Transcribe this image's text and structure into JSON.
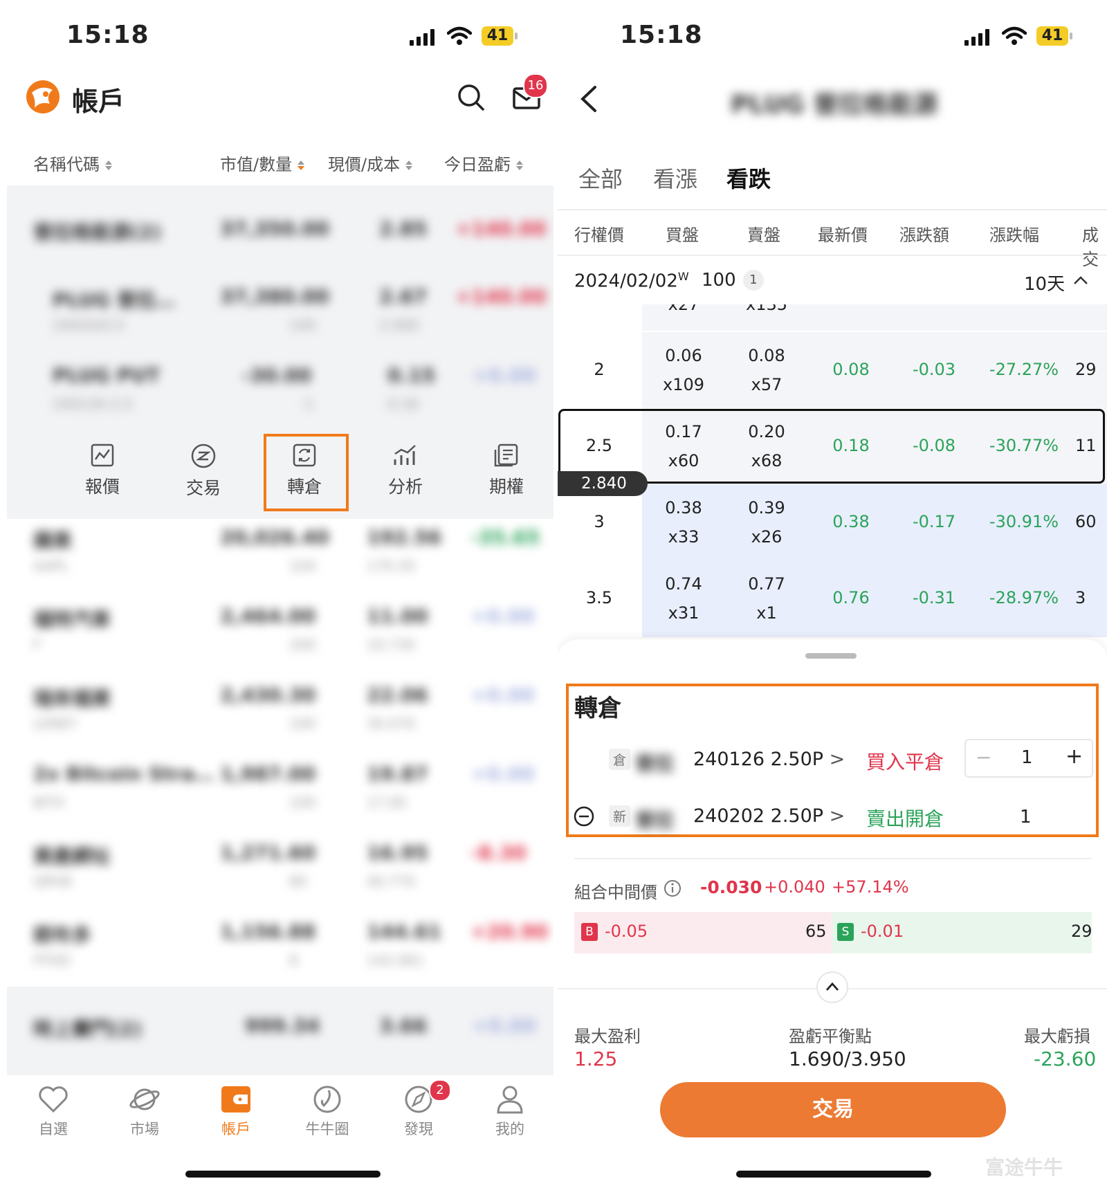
{
  "left": {
    "status": {
      "time": "15:18",
      "battery": "41"
    },
    "header": {
      "title": "帳戶",
      "mail_badge": "16"
    },
    "columns": [
      "名稱代碼",
      "市值/數量",
      "現價/成本",
      "今日盈虧"
    ],
    "group_row": {
      "name": "普拉格能源(2)",
      "value": "37,350.00",
      "price": "2.85",
      "pl": "+140.00"
    },
    "sub_rows": [
      {
        "name": "PLUG 普拉…",
        "code": "240202C3",
        "value": "37,380.00",
        "qty": "140",
        "price": "2.67",
        "cost": "2.000",
        "pl": "+140.00"
      },
      {
        "name": "PLUG PUT",
        "code": "240126-2.5",
        "value": "-30.00",
        "qty": "-1",
        "price": "0.15",
        "cost": "0.18",
        "pl": "+0.00"
      }
    ],
    "actions": [
      {
        "label": "報價",
        "icon": "quote-chart-icon"
      },
      {
        "label": "交易",
        "icon": "trade-icon"
      },
      {
        "label": "轉倉",
        "icon": "roll-position-icon"
      },
      {
        "label": "分析",
        "icon": "analysis-icon"
      },
      {
        "label": "期權",
        "icon": "options-icon"
      }
    ],
    "holdings": [
      {
        "name": "蘋果",
        "code": "AAPL",
        "value": "20,026.40",
        "qty": "104",
        "price": "192.56",
        "cost": "170.20",
        "pl": "-35.65",
        "plcolor": "#2ba35a"
      },
      {
        "name": "福特汽車",
        "code": "F",
        "value": "2,464.00",
        "qty": "200",
        "price": "11.00",
        "cost": "10.730",
        "pl": "+0.00",
        "plcolor": "#a9b5e0"
      },
      {
        "name": "瑞來福資",
        "code": "LENEY",
        "value": "2,430.30",
        "qty": "100",
        "price": "22.06",
        "cost": "30.070",
        "pl": "+0.00",
        "plcolor": "#a9b5e0"
      },
      {
        "name": "2x Bitcoin Stra…",
        "code": "BITX",
        "value": "1,987.00",
        "qty": "100",
        "price": "19.87",
        "cost": "17.00",
        "pl": "+0.00",
        "plcolor": "#a9b5e0"
      },
      {
        "name": "資產網址",
        "code": "QRHE",
        "value": "1,271.60",
        "qty": "80",
        "price": "16.95",
        "cost": "40.770",
        "pl": "-8.30",
        "plcolor": "#e0354b"
      },
      {
        "name": "朗布多",
        "code": "FFDD",
        "value": "1,156.88",
        "qty": "8",
        "price": "144.61",
        "cost": "142.061",
        "pl": "+20.90",
        "plcolor": "#e0354b"
      }
    ],
    "footer_group": {
      "name": "時上賽門(2)",
      "value": "999.34",
      "price": "3.66",
      "pl": "+0.00"
    },
    "nav": [
      {
        "label": "自選",
        "icon": "heart-icon"
      },
      {
        "label": "市場",
        "icon": "planet-icon"
      },
      {
        "label": "帳戶",
        "icon": "wallet-icon"
      },
      {
        "label": "牛牛圈",
        "icon": "community-icon"
      },
      {
        "label": "發現",
        "icon": "compass-icon",
        "badge": "2"
      },
      {
        "label": "我的",
        "icon": "user-icon"
      }
    ]
  },
  "right": {
    "status": {
      "time": "15:18",
      "battery": "41"
    },
    "title": "PLUG 普拉格能源",
    "tabs": [
      "全部",
      "看漲",
      "看跌"
    ],
    "columns": [
      "行權價",
      "買盤",
      "賣盤",
      "最新價",
      "漲跌額",
      "漲跌幅",
      "成交"
    ],
    "expiry": {
      "date": "2024/02/02",
      "sup": "W",
      "size": "100",
      "count": "1",
      "days": "10天"
    },
    "partial_row": {
      "bid_size": "x27",
      "ask_size": "x135"
    },
    "rows": [
      {
        "strike": "2",
        "bid": "0.06",
        "bid_size": "x109",
        "ask": "0.08",
        "ask_size": "x57",
        "last": "0.08",
        "chg": "-0.03",
        "pct": "-27.27%",
        "vol": "29"
      },
      {
        "strike": "2.5",
        "bid": "0.17",
        "bid_size": "x60",
        "ask": "0.20",
        "ask_size": "x68",
        "last": "0.18",
        "chg": "-0.08",
        "pct": "-30.77%",
        "vol": "11"
      },
      {
        "strike": "3",
        "bid": "0.38",
        "bid_size": "x33",
        "ask": "0.39",
        "ask_size": "x26",
        "last": "0.38",
        "chg": "-0.17",
        "pct": "-30.91%",
        "vol": "60"
      },
      {
        "strike": "3.5",
        "bid": "0.74",
        "bid_size": "x31",
        "ask": "0.77",
        "ask_size": "x1",
        "last": "0.76",
        "chg": "-0.31",
        "pct": "-28.97%",
        "vol": "3"
      }
    ],
    "underlying_price": "2.840",
    "sheet": {
      "title": "轉倉",
      "leg1": {
        "tag": "倉",
        "name_blur": "普拉",
        "contract": "240126 2.50P",
        "action": "買入平倉",
        "qty": "1",
        "minus": "−",
        "plus": "+"
      },
      "leg2": {
        "tag": "新",
        "name_blur": "普拉",
        "contract": "240202 2.50P",
        "action": "賣出開倉",
        "qty": "1"
      },
      "combo_label": "組合中間價",
      "combo_price": "-0.030",
      "combo_chg": "+0.040",
      "combo_pct": "+57.14%",
      "bid_tag": "B",
      "bid_val": "-0.05",
      "bid_size": "65",
      "ask_tag": "S",
      "ask_val": "-0.01",
      "ask_size": "29",
      "max_profit_label": "最大盈利",
      "max_profit": "1.25",
      "breakeven_label": "盈虧平衡點",
      "breakeven": "1.690/3.950",
      "max_loss_label": "最大虧損",
      "max_loss": "-23.60",
      "trade_button": "交易",
      "watermark": "富途牛牛"
    }
  }
}
